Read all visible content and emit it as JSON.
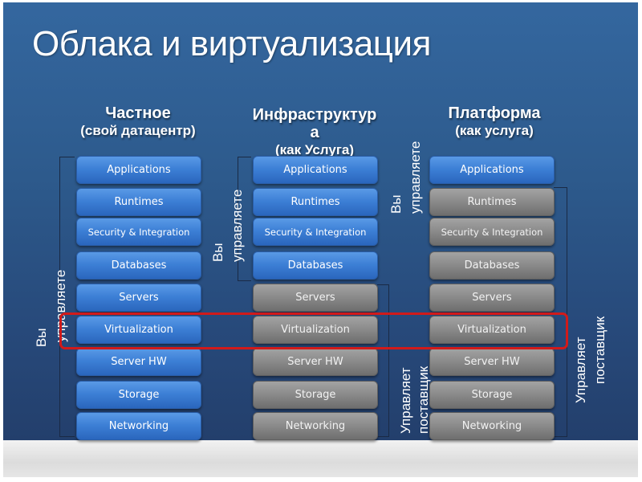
{
  "slide": {
    "title": "Облака и виртуализация"
  },
  "columns": [
    {
      "heading_line1": "Частное",
      "heading_line2": "(свой датацентр)",
      "you_manage_label": [
        "Вы",
        "управляете"
      ],
      "vendor_manages_label": null,
      "layers": [
        {
          "label": "Applications",
          "managed_by": "you"
        },
        {
          "label": "Runtimes",
          "managed_by": "you"
        },
        {
          "label": "Security & Integration",
          "managed_by": "you"
        },
        {
          "label": "Databases",
          "managed_by": "you"
        },
        {
          "label": "Servers",
          "managed_by": "you"
        },
        {
          "label": "Virtualization",
          "managed_by": "you"
        },
        {
          "label": "Server HW",
          "managed_by": "you"
        },
        {
          "label": "Storage",
          "managed_by": "you"
        },
        {
          "label": "Networking",
          "managed_by": "you"
        }
      ]
    },
    {
      "heading_line1": "Инфраструктур",
      "heading_line2": "а",
      "heading_line3": "(как Услуга)",
      "you_manage_label": [
        "Вы",
        "управляете"
      ],
      "vendor_manages_label": [
        "Управляет",
        "поставщик"
      ],
      "layers": [
        {
          "label": "Applications",
          "managed_by": "you"
        },
        {
          "label": "Runtimes",
          "managed_by": "you"
        },
        {
          "label": "Security & Integration",
          "managed_by": "you"
        },
        {
          "label": "Databases",
          "managed_by": "you"
        },
        {
          "label": "Servers",
          "managed_by": "vendor"
        },
        {
          "label": "Virtualization",
          "managed_by": "vendor"
        },
        {
          "label": "Server HW",
          "managed_by": "vendor"
        },
        {
          "label": "Storage",
          "managed_by": "vendor"
        },
        {
          "label": "Networking",
          "managed_by": "vendor"
        }
      ]
    },
    {
      "heading_line1": "Платформа",
      "heading_line2": "(как услуга)",
      "you_manage_label": [
        "Вы",
        "управляете"
      ],
      "vendor_manages_label": [
        "Управляет",
        "поставщик"
      ],
      "layers": [
        {
          "label": "Applications",
          "managed_by": "you"
        },
        {
          "label": "Runtimes",
          "managed_by": "vendor"
        },
        {
          "label": "Security & Integration",
          "managed_by": "vendor"
        },
        {
          "label": "Databases",
          "managed_by": "vendor"
        },
        {
          "label": "Servers",
          "managed_by": "vendor"
        },
        {
          "label": "Virtualization",
          "managed_by": "vendor"
        },
        {
          "label": "Server HW",
          "managed_by": "vendor"
        },
        {
          "label": "Storage",
          "managed_by": "vendor"
        },
        {
          "label": "Networking",
          "managed_by": "vendor"
        }
      ]
    }
  ],
  "highlighted_layer": "Virtualization",
  "colors": {
    "you_manage": "#3d80d6",
    "vendor_manages": "#8c8c8c",
    "highlight": "#d11a1a",
    "background": "#2d5a8c"
  }
}
